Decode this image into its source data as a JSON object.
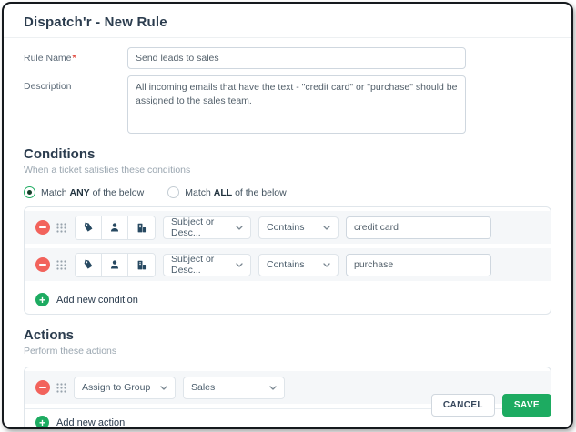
{
  "page": {
    "title": "Dispatch'r - New Rule"
  },
  "form": {
    "rule_name": {
      "label": "Rule Name",
      "required_mark": "*",
      "value": "Send leads to sales"
    },
    "description": {
      "label": "Description",
      "value": "All incoming emails that have the text - \"credit card\" or \"purchase\" should be assigned to the sales team."
    }
  },
  "conditions": {
    "heading": "Conditions",
    "subheading": "When a ticket satisfies these conditions",
    "match_any": {
      "prefix": "Match",
      "keyword": "ANY",
      "suffix": "of the below"
    },
    "match_all": {
      "prefix": "Match",
      "keyword": "ALL",
      "suffix": "of the below"
    },
    "selected_option": "match_any",
    "rows": [
      {
        "field": "Subject or Desc...",
        "operator": "Contains",
        "value": "credit card"
      },
      {
        "field": "Subject or Desc...",
        "operator": "Contains",
        "value": "purchase"
      }
    ],
    "add_label": "Add new condition"
  },
  "actions": {
    "heading": "Actions",
    "subheading": "Perform these actions",
    "rows": [
      {
        "field": "Assign to Group",
        "value": "Sales"
      }
    ],
    "add_label": "Add new action"
  },
  "footer": {
    "cancel_label": "CANCEL",
    "save_label": "SAVE"
  },
  "colors": {
    "accent_green": "#1dab61",
    "danger_red": "#f2635c",
    "heading": "#2b3c4e"
  },
  "icons": {
    "row_icons": [
      "ticket-tag-icon",
      "contact-person-icon",
      "company-building-icon"
    ]
  }
}
